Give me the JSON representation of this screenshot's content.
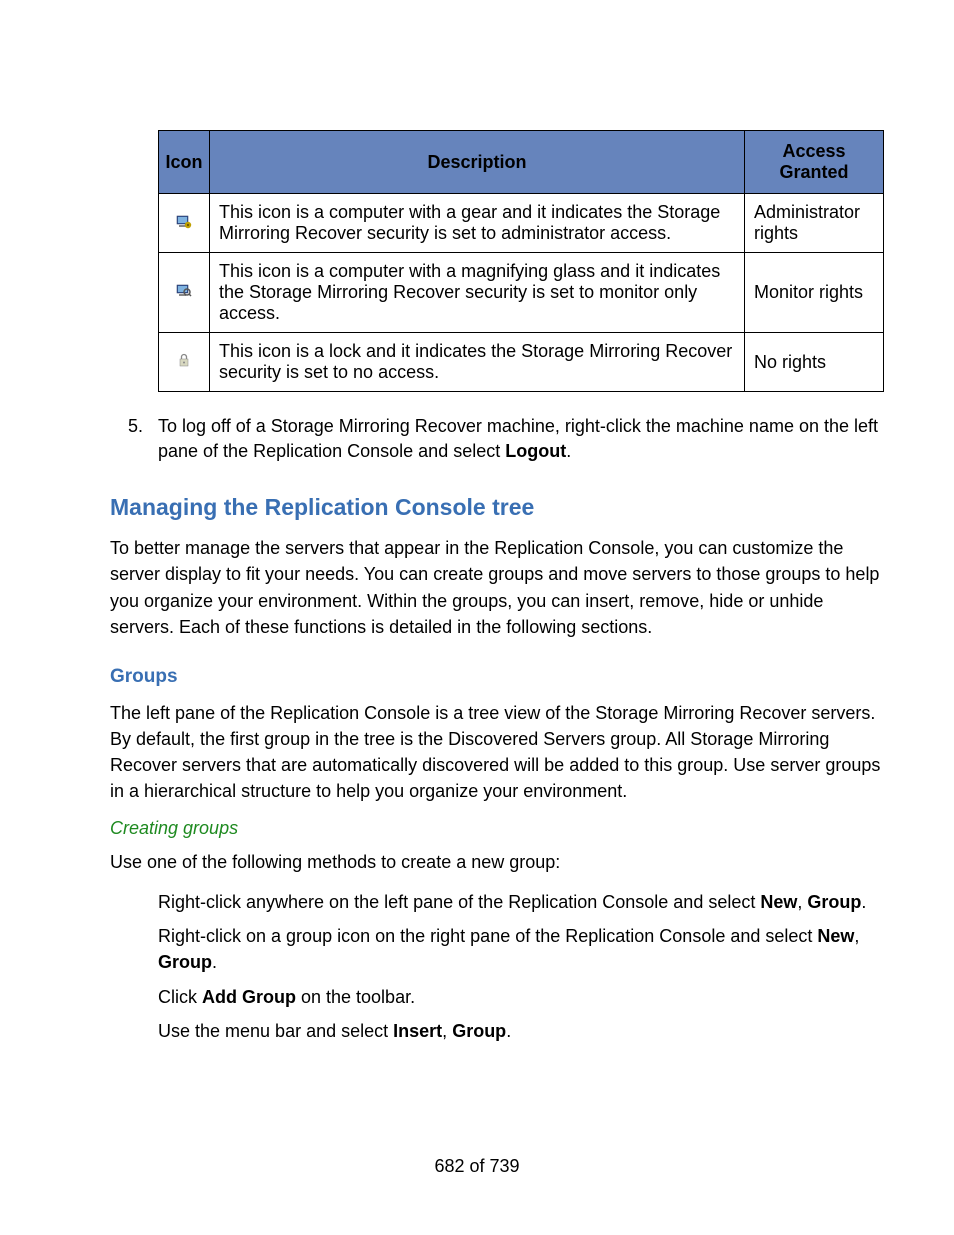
{
  "table": {
    "headers": {
      "icon": "Icon",
      "desc": "Description",
      "access": "Access Granted"
    },
    "rows": [
      {
        "icon_name": "computer-gear-icon",
        "desc": "This icon is a computer with a gear and it indicates the Storage Mirroring Recover security is set to administrator access.",
        "access": "Administrator rights"
      },
      {
        "icon_name": "computer-magnify-icon",
        "desc": "This icon is a computer with a magnifying glass and it indicates the Storage Mirroring Recover security is set to monitor only access.",
        "access": "Monitor rights"
      },
      {
        "icon_name": "lock-icon",
        "desc": "This icon is a lock and it indicates the Storage Mirroring Recover security is set to no access.",
        "access": "No rights"
      }
    ]
  },
  "ol5": {
    "num": "5.",
    "pre": "To log off of a Storage Mirroring Recover machine, right-click the machine name on the left pane of the Replication Console and select ",
    "bold": "Logout",
    "post": "."
  },
  "h3": "Managing the Replication Console tree",
  "p1": "To better manage the servers that appear in the Replication Console, you can customize the server display to fit your needs. You can create groups and move servers to those groups to help you organize your environment. Within the groups, you can insert, remove, hide or unhide servers. Each of these functions is detailed in the following sections.",
  "h4": "Groups",
  "p2": "The left pane of the Replication Console is a tree view of the Storage Mirroring Recover servers. By default, the first group in the tree is the Discovered Servers group. All Storage Mirroring Recover servers that are automatically discovered will be added to this group. Use server groups in a hierarchical structure to help you organize your environment.",
  "h5": "Creating groups",
  "p3": "Use one of the following methods to create a new group:",
  "m1": {
    "pre": "Right-click anywhere on the left pane of the Replication Console and select ",
    "b1": "New",
    "mid": ", ",
    "b2": "Group",
    "post": "."
  },
  "m2": {
    "pre": "Right-click on a group icon on the right pane of the Replication Console and select ",
    "b1": "New",
    "mid": ", ",
    "b2": "Group",
    "post": "."
  },
  "m3": {
    "pre": "Click ",
    "b1": "Add Group",
    "post": " on the toolbar."
  },
  "m4": {
    "pre": "Use the menu bar and select ",
    "b1": "Insert",
    "mid": ", ",
    "b2": "Group",
    "post": "."
  },
  "pgnum": "682 of 739"
}
